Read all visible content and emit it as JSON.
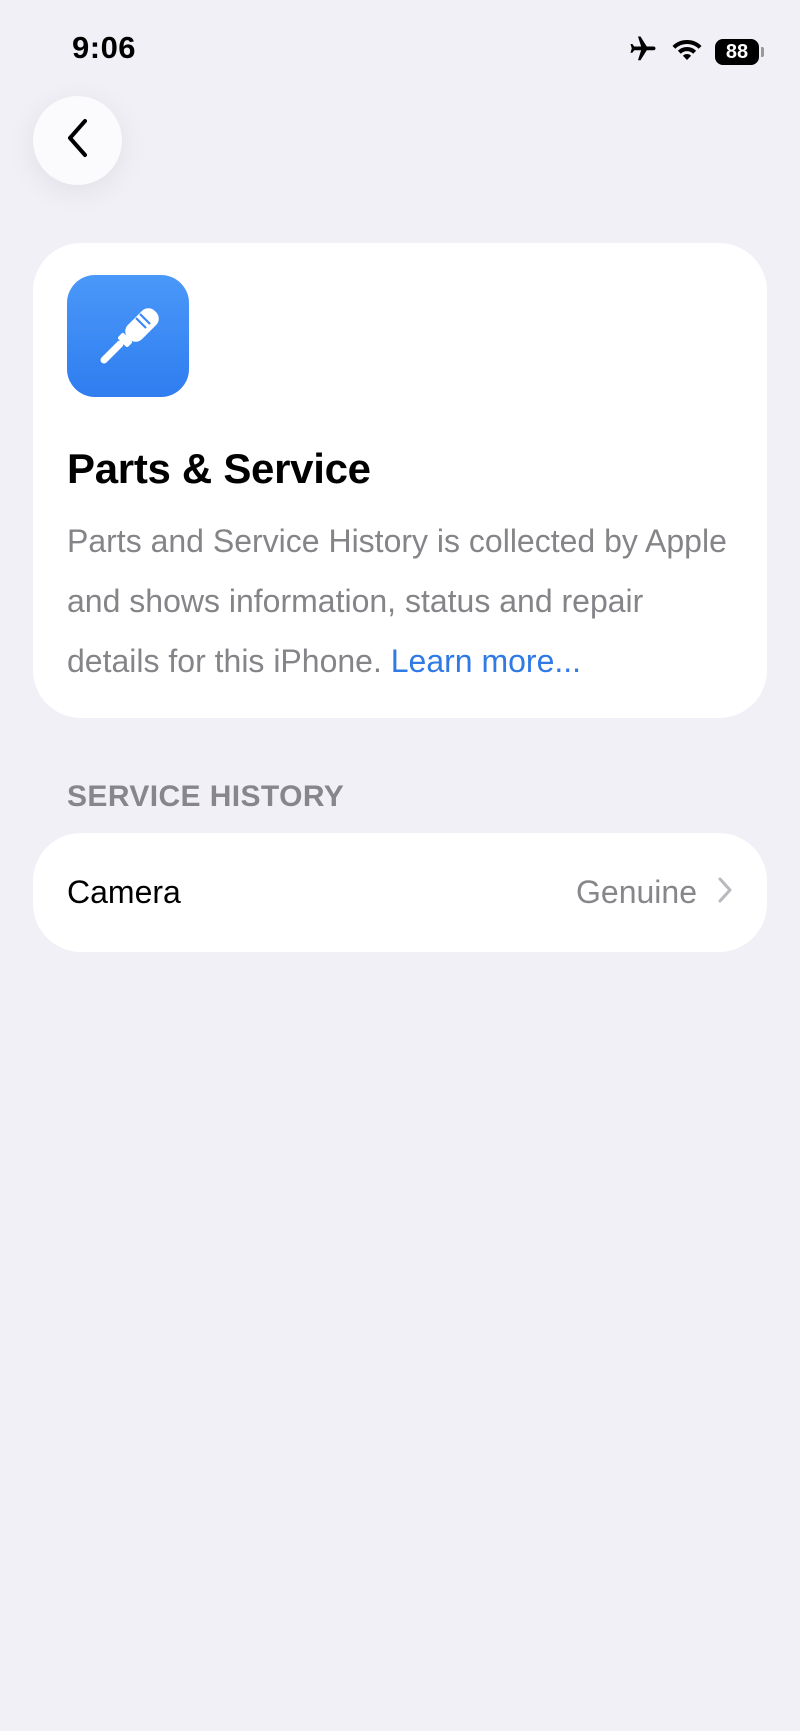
{
  "status_bar": {
    "time": "9:06",
    "battery_level": "88",
    "icons": [
      "airplane-icon",
      "wifi-icon",
      "battery-icon"
    ]
  },
  "nav": {
    "back_icon": "chevron-left-icon"
  },
  "card": {
    "icon": "screwdriver-icon",
    "icon_color": "#3b89f5",
    "title": "Parts & Service",
    "description": "Parts and Service History is collected by Apple and shows information, status and repair details for this iPhone.",
    "learn_more": "Learn more..."
  },
  "service_history": {
    "header": "SERVICE HISTORY",
    "rows": [
      {
        "label": "Camera",
        "value": "Genuine"
      }
    ]
  },
  "colors": {
    "background": "#f0f0f6",
    "link": "#2f7ae5",
    "secondary_text": "#86868b"
  }
}
